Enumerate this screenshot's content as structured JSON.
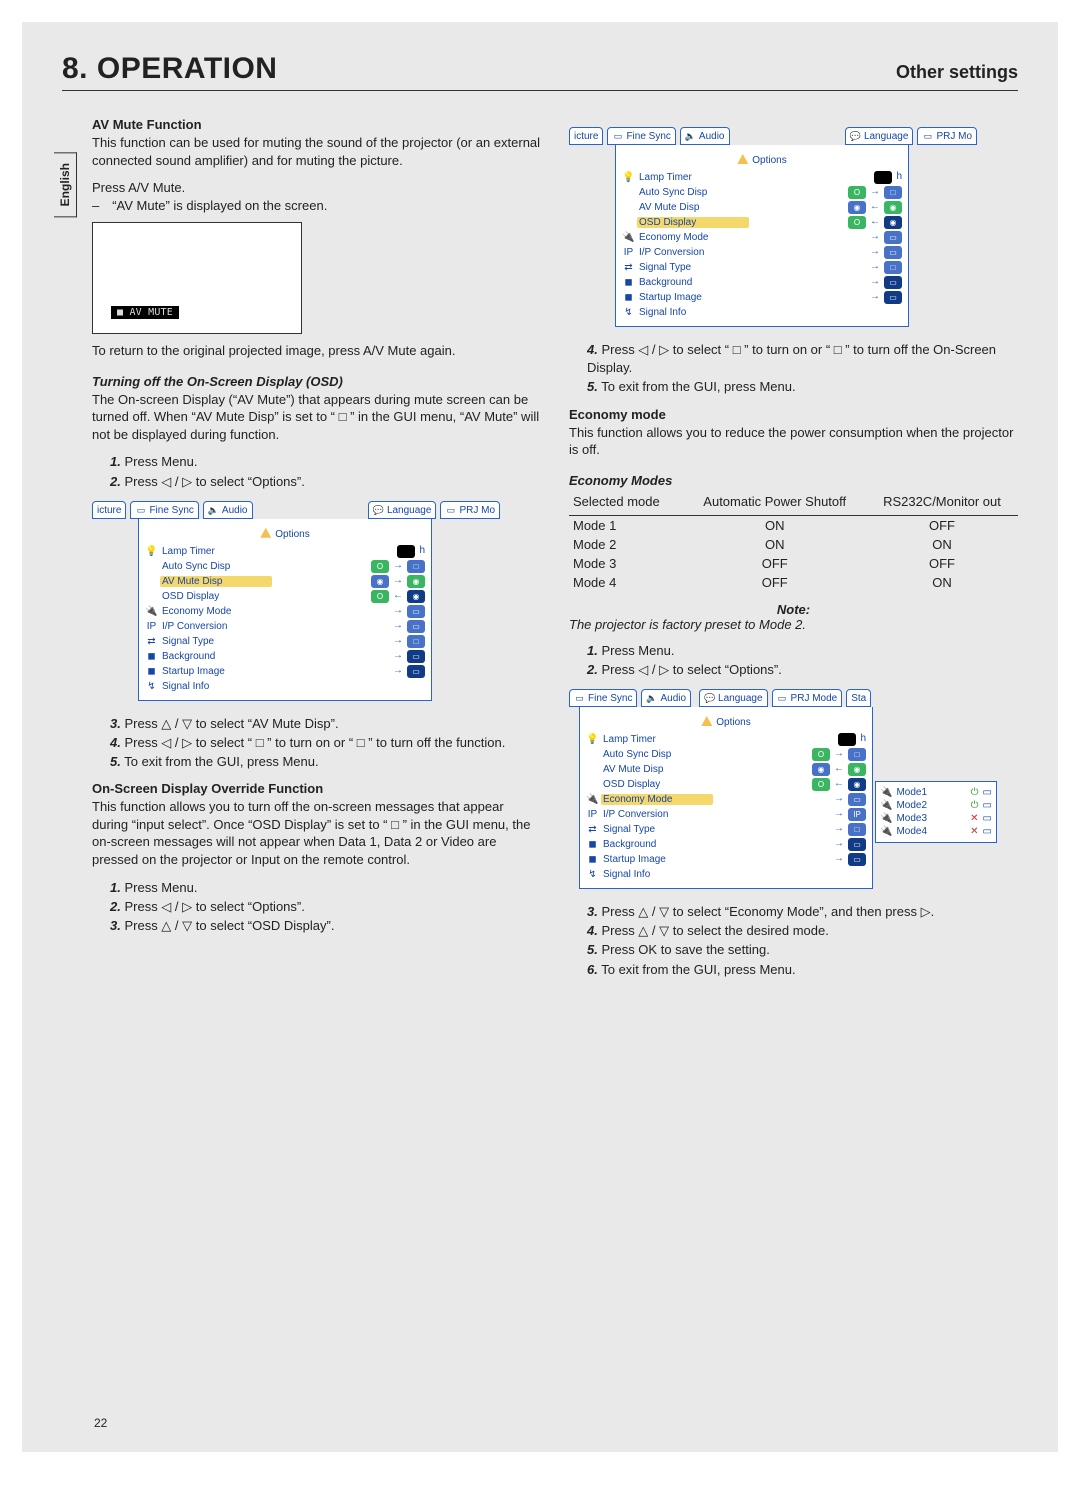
{
  "header": {
    "title": "8. OPERATION",
    "subtitle": "Other settings"
  },
  "side_tab": "English",
  "page_number": "22",
  "left_col": {
    "avmute": {
      "heading": "AV Mute Function",
      "p1": "This function can be used for muting the sound of the projector (or an external connected sound amplifier) and for muting the picture.",
      "press": "Press A/V Mute.",
      "bullet": "– “AV Mute” is displayed on the screen.",
      "badge": "■ AV MUTE",
      "return": "To return to the original projected image, press A/V Mute again."
    },
    "osd_off": {
      "heading": "Turning off the On-Screen Display (OSD)",
      "p1": "The On-screen Display (“AV Mute”) that appears during mute screen can be turned off. When “AV Mute Disp” is set to “ □ ” in the GUI menu, “AV Mute” will not be displayed during function.",
      "s1": "Press Menu.",
      "s2": "Press ◁ / ▷ to select “Options”.",
      "s3": "Press △ / ▽ to select “AV Mute Disp”.",
      "s4": "Press ◁ / ▷ to select “ □ ” to turn on or “ □ ” to turn off the function.",
      "s5": "To exit from the GUI, press Menu."
    },
    "override": {
      "heading": "On-Screen Display Override Function",
      "p1": "This function allows you to turn off the on-screen messages that appear during “input select”. Once “OSD Display” is set to “ □ ” in the GUI menu, the on-screen messages will not appear when Data 1, Data 2 or Video are pressed on the projector or Input on the remote control.",
      "s1": "Press Menu.",
      "s2": "Press ◁ / ▷ to select “Options”.",
      "s3": "Press △ / ▽ to select “OSD Display”."
    }
  },
  "right_col": {
    "osd_override": {
      "s4": "Press ◁ / ▷ to select “ □ ” to turn on or “ □ ” to turn off the On-Screen Display.",
      "s5": "To exit from the GUI, press Menu."
    },
    "economy": {
      "heading": "Economy mode",
      "p1": "This function allows you to reduce the power consumption when the projector is off.",
      "table_heading": "Economy Modes",
      "cols": [
        "Selected mode",
        "Automatic Power Shutoff",
        "RS232C/Monitor out"
      ],
      "rows": [
        [
          "Mode 1",
          "ON",
          "OFF"
        ],
        [
          "Mode 2",
          "ON",
          "ON"
        ],
        [
          "Mode 3",
          "OFF",
          "OFF"
        ],
        [
          "Mode 4",
          "OFF",
          "ON"
        ]
      ],
      "note_lbl": "Note:",
      "note": "The projector is factory preset to Mode 2.",
      "s1": "Press Menu.",
      "s2": "Press ◁ / ▷ to select “Options”.",
      "s3": "Press △ / ▽ to select “Economy Mode”, and then press ▷.",
      "s4": "Press △ / ▽ to select the desired mode.",
      "s5": "Press OK to save the setting.",
      "s6": "To exit from the GUI, press Menu."
    }
  },
  "gui": {
    "tabs": [
      "icture",
      "Fine Sync",
      "Audio",
      "Language",
      "PRJ Mo"
    ],
    "tabs3": [
      "Fine Sync",
      "Audio",
      "Language",
      "PRJ Mode",
      "Sta"
    ],
    "panel_title": "Options",
    "lamp_timer": "Lamp Timer",
    "lamp_h": "h",
    "rows": {
      "auto_sync": "Auto Sync Disp",
      "av_mute": "AV Mute Disp",
      "osd": "OSD Display",
      "economy": "Economy Mode",
      "ip": "I/P Conversion",
      "signal_type": "Signal Type",
      "background": "Background",
      "startup": "Startup Image",
      "signal_info": "Signal Info"
    },
    "modes": [
      "Mode1",
      "Mode2",
      "Mode3",
      "Mode4"
    ]
  }
}
